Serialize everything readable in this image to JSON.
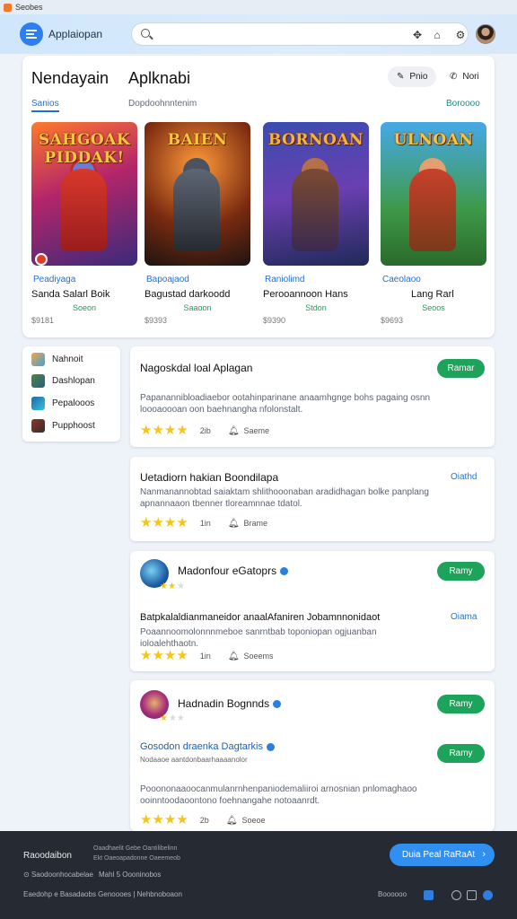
{
  "window": {
    "title": "Seobes"
  },
  "header": {
    "brand": "Applaiopan",
    "search_placeholder": "",
    "icons": [
      "puzzle-icon",
      "gift-icon",
      "settings-icon"
    ]
  },
  "featured": {
    "title_left": "Nendayain",
    "title_right": "Aplknabi",
    "pills": [
      {
        "label": "Pnio",
        "icon": "brush-icon"
      },
      {
        "label": "Nori",
        "icon": "chat-icon"
      }
    ],
    "tabs": {
      "active": "Sanios",
      "middle": "Dopdoohnntenim",
      "right": "Boroooo"
    },
    "games": [
      {
        "art_title": "SAHGOAK PIDDAK!",
        "category": "Peadiyaga",
        "name": "Sanda Salarl Boik",
        "subtitle": "Soeon",
        "price": "$9181"
      },
      {
        "art_title": "BAIEN",
        "category": "Bapoajaod",
        "name": "Bagustad darkoodd",
        "subtitle": "Saaoon",
        "price": "$9393"
      },
      {
        "art_title": "BORNOAN",
        "category": "Raniolimd",
        "name": "Perooannoon Hans",
        "subtitle": "Stdon",
        "price": "$9390"
      },
      {
        "art_title": "ULNOAN",
        "category": "Caeolaoo",
        "name": "Lang Rarl",
        "subtitle": "Seoos",
        "price": "$9693"
      }
    ]
  },
  "sidebar": {
    "items": [
      "Nahnoit",
      "Dashlopan",
      "Pepalooos",
      "Pupphoost"
    ]
  },
  "apps": [
    {
      "title": "Nagoskdal loal Aplagan",
      "desc": "Papanannibloadiaebor ootahinparinane anaamhgnge bohs pagaing osnn loooaoooan oon baehnangha nfolonstalt.",
      "action": "Ramar",
      "stars": "★★★★",
      "count": "2ib",
      "share": "Saeme"
    },
    {
      "title": "Uetadiorn hakian Boondilapa",
      "desc": "Nanmanannobtad saiaktam shlithooonaban aradidhagan bolke panplang apnannaaon tbenner tloreamnnae tdatol.",
      "link": "Oiathd",
      "stars": "★★★★",
      "count": "1in",
      "share": "Brame"
    },
    {
      "title": "Madonfour eGatoprs",
      "title2": "Batpkalaldianmaneidor anaalAfaniren Jobamnnonidaot",
      "desc": "Poaannoomolonnnmeboe sanrntbab toponiopan ogjuanban ioloalehthaotn.",
      "action": "Ramy",
      "link": "Oiama",
      "stars": "★★★★",
      "count": "1in",
      "share": "Soeems"
    },
    {
      "title": "Hadnadin Bognnds",
      "title2": "Gosodon draenka Dagtarkis",
      "meta": "Nodaaoe aantdonbaarhaaaanolor",
      "desc": "Pooononaaoocanmulanrnhenpaniodemaliiroi arnosnian pnlomaghaoo ooinntoodaoontono foehnangahe notoaanrdt.",
      "action": "Ramy",
      "action2": "Ramy",
      "stars": "★★★★",
      "count": "2b",
      "share": "Soeoe"
    }
  ],
  "footer": {
    "title": "Raoodaibon",
    "small_lines": [
      "Oaadhaelit Gebe Oantilibelinn",
      "Ekt Oaeoapadonne Oaeemeob"
    ],
    "line1": "Saodoonhocabelae",
    "line1b": "Mahl 5 Oooninobos",
    "line2": "Eaedohp e Basadaobs Genoooes | Nehbnoboaon",
    "cta": "Duia Peal RaRaAt",
    "right_text": "Boooooo"
  },
  "colors": {
    "accent": "#2d7ef0",
    "green": "#1ea35a",
    "footer_bg": "#262b33",
    "star": "#f5c518"
  }
}
